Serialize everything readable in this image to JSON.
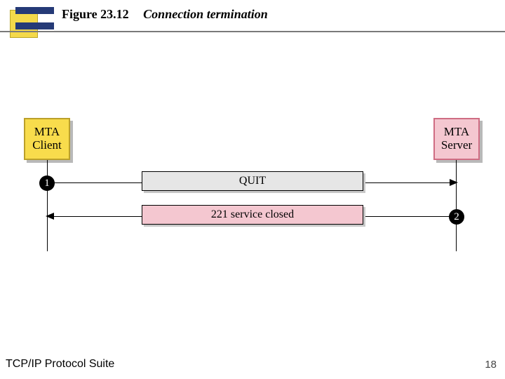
{
  "header": {
    "figure_label": "Figure 23.12",
    "caption": "Connection termination"
  },
  "diagram": {
    "client_box": {
      "line1": "MTA",
      "line2": "Client"
    },
    "server_box": {
      "line1": "MTA",
      "line2": "Server"
    },
    "step1": "1",
    "step2": "2",
    "msg1": "QUIT",
    "msg2": "221 service closed"
  },
  "footer": {
    "text": "TCP/IP Protocol Suite",
    "page": "18"
  }
}
